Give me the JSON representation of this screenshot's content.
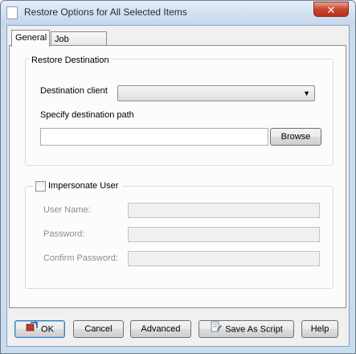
{
  "window": {
    "title": "Restore Options for All Selected Items",
    "close_glyph": "✕"
  },
  "tabs": [
    {
      "label": "General",
      "active": true
    },
    {
      "label": "Job Initiation",
      "active": false
    }
  ],
  "restore_destination": {
    "group_title": "Restore Destination",
    "destination_client_label": "Destination client",
    "destination_client_value": "",
    "path_label": "Specify destination path",
    "path_value": "",
    "browse_label": "Browse"
  },
  "impersonate": {
    "checkbox_label": "Impersonate User",
    "checked": false,
    "user_name_label": "User Name:",
    "user_name_value": "",
    "password_label": "Password:",
    "password_value": "",
    "confirm_password_label": "Confirm Password:",
    "confirm_password_value": ""
  },
  "buttons": {
    "ok": "OK",
    "cancel": "Cancel",
    "advanced": "Advanced",
    "save_as_script": "Save As Script",
    "help": "Help"
  },
  "icons": {
    "ok_icon": "restore-icon",
    "script_icon": "script-icon",
    "dropdown_icon": "chevron-down-icon"
  }
}
